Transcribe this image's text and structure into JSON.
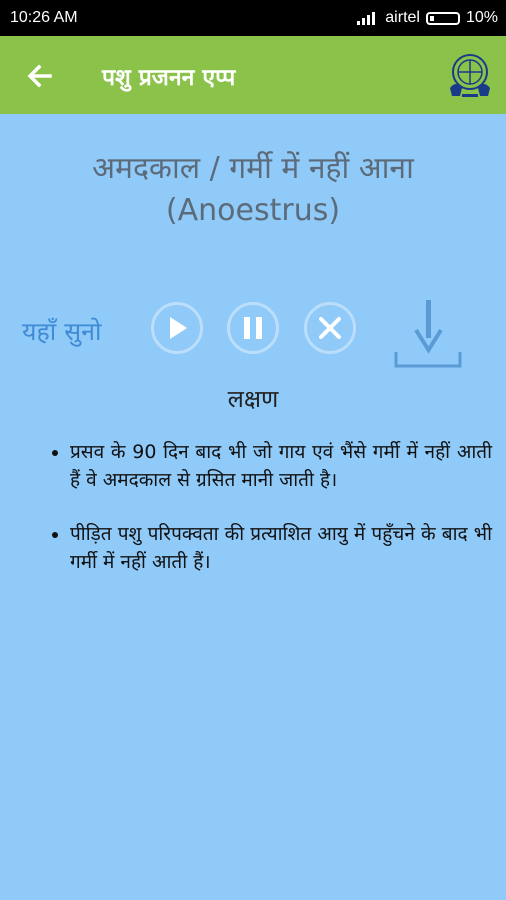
{
  "status_bar": {
    "time": "10:26",
    "am_pm": "AM",
    "carrier": "airtel",
    "battery": "10%"
  },
  "app_bar": {
    "title": "पशु प्रजनन एप्प"
  },
  "page": {
    "title_line1": "अमदकाल / गर्मी में नहीं आना",
    "title_line2": "(Anoestrus)"
  },
  "audio": {
    "listen_label": "यहाँ सुनो"
  },
  "symptoms": {
    "heading": "लक्षण",
    "items": [
      "प्रसव के 90 दिन बाद भी जो गाय एवं भैंसे गर्मी में नहीं आती हैं वे अमदकाल से ग्रसित मानी जाती है।",
      "पीड़ित पशु परिपक्वता की प्रत्याशित आयु में पहुँचने के बाद भी गर्मी में नहीं आती हैं।"
    ]
  },
  "colors": {
    "app_bar": "#8bc34a",
    "background": "#90caf9",
    "accent": "#3f8bd6"
  }
}
